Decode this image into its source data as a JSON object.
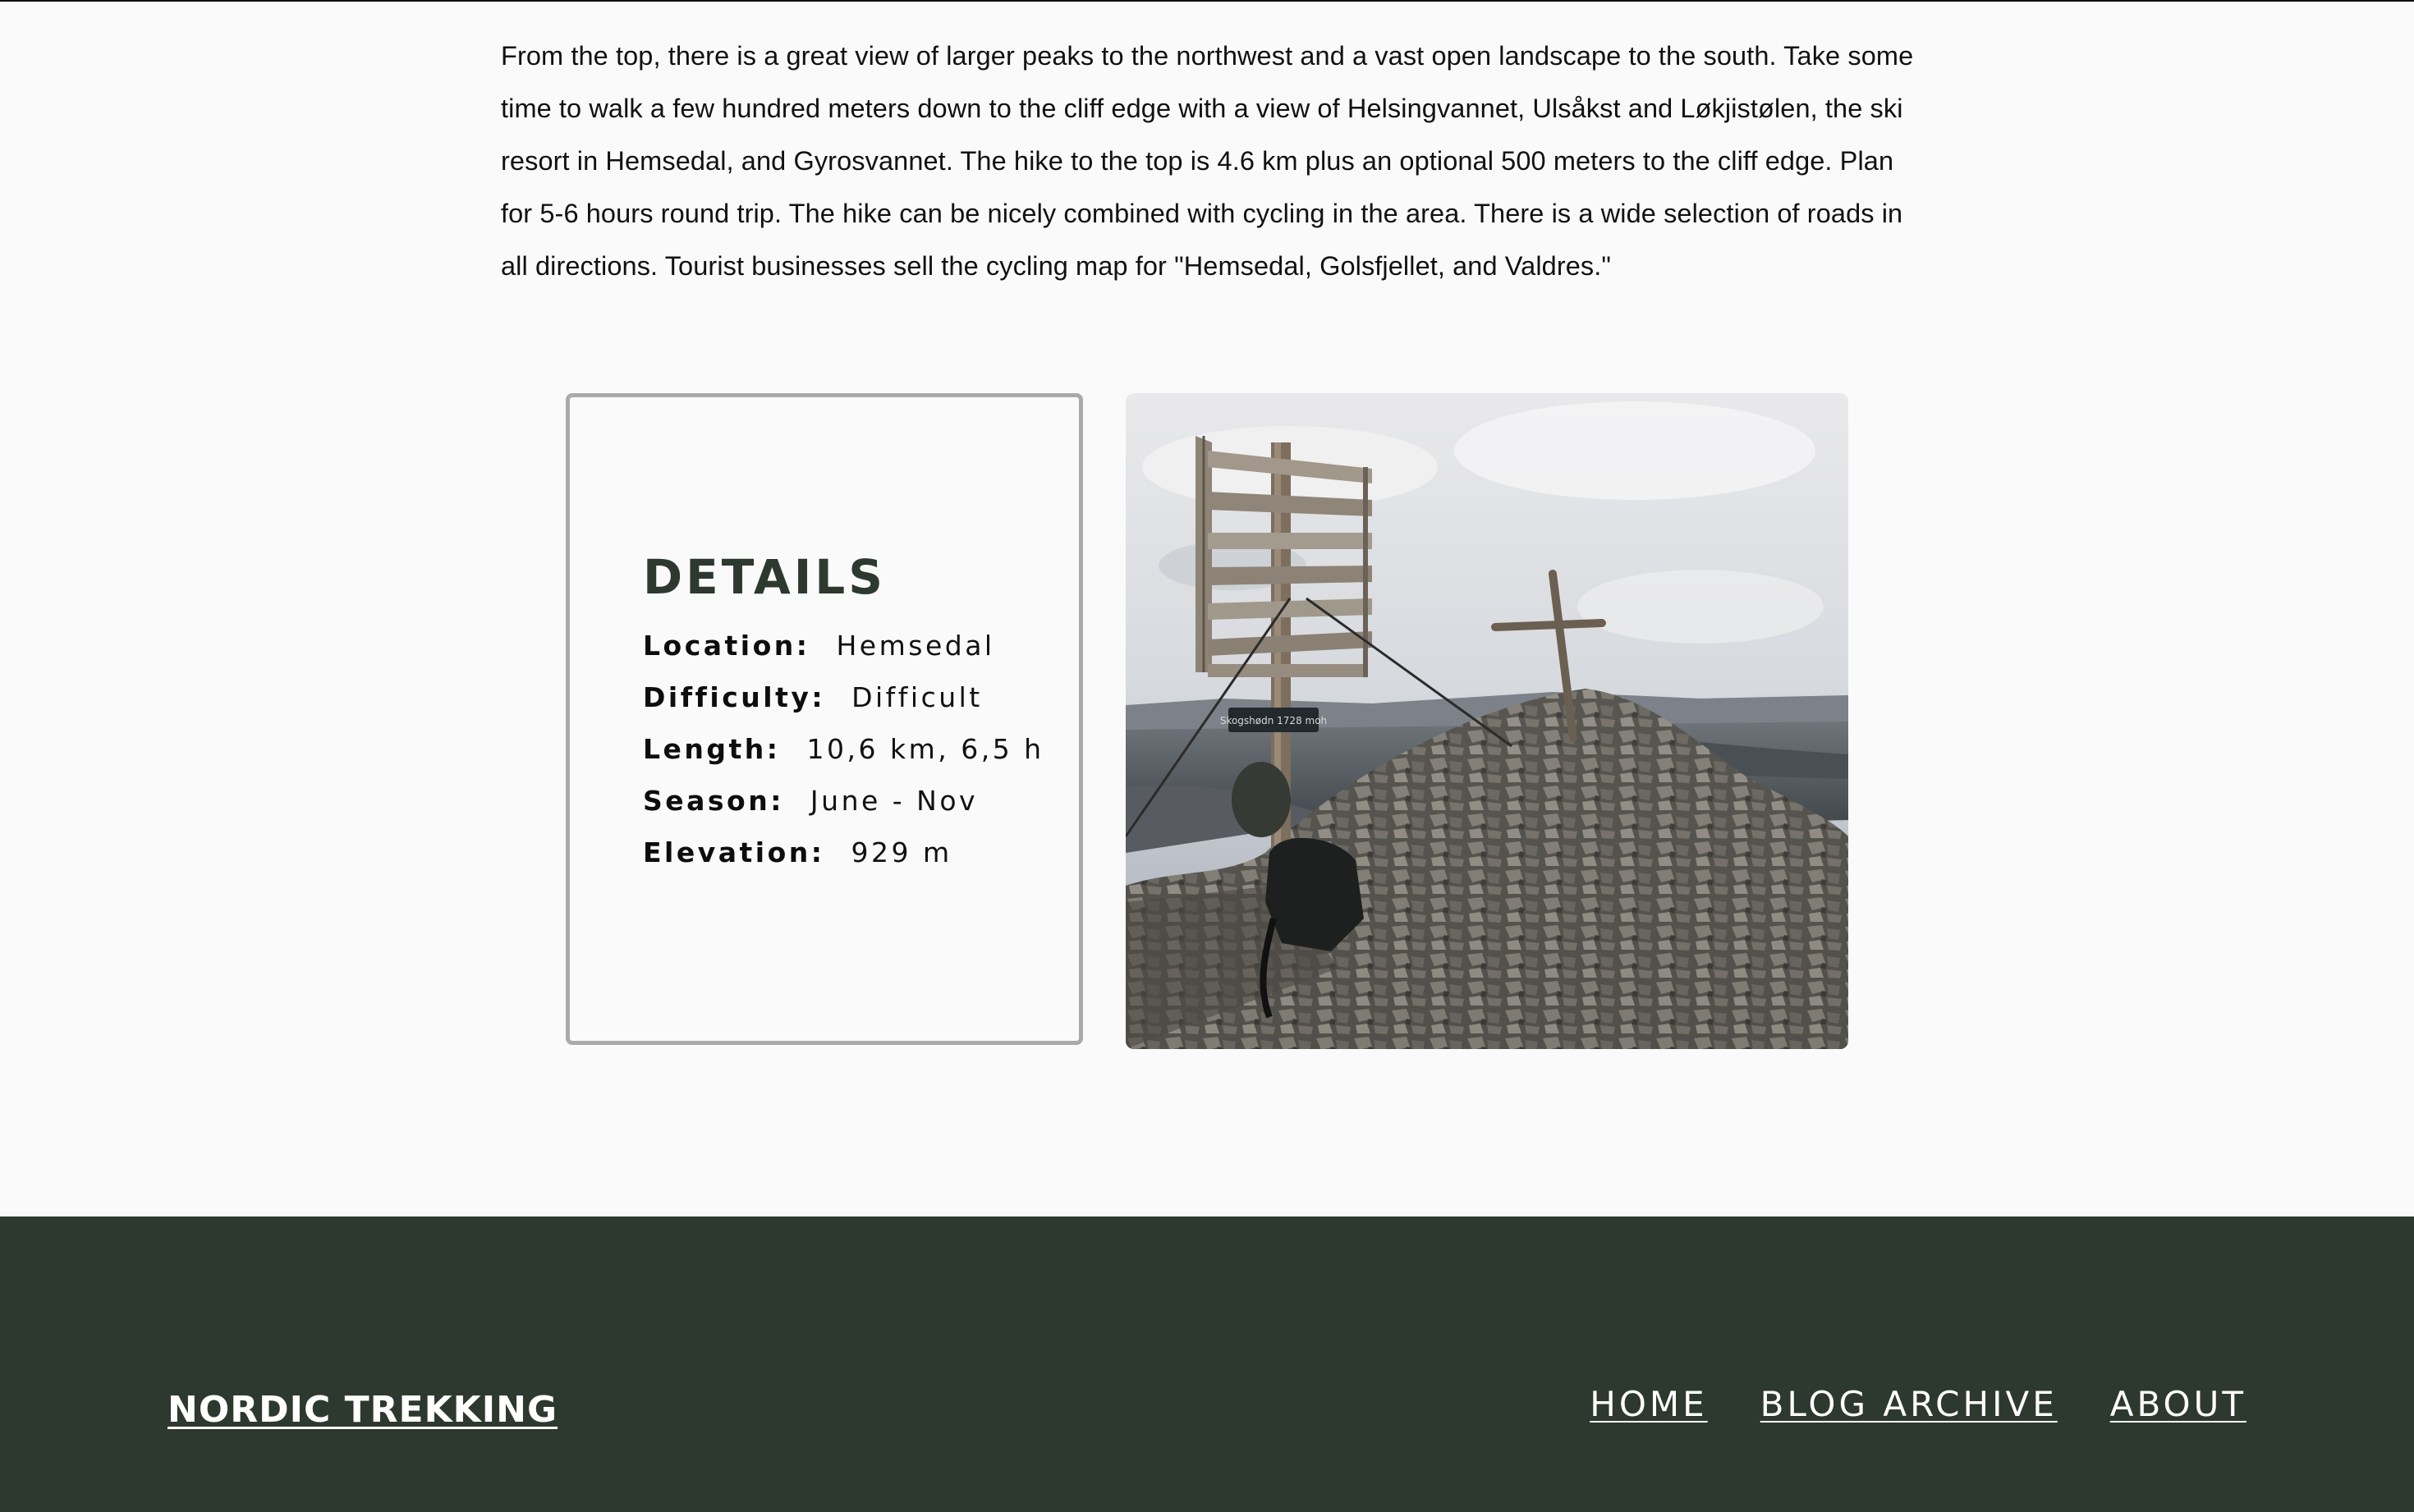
{
  "article": {
    "intro_text": "From the top, there is a great view of larger peaks to the northwest and a vast open landscape to the south. Take some time to walk a few hundred meters down to the cliff edge with a view of Helsingvannet, Ulsåkst and Løkjistølen, the ski resort in Hemsedal, and Gyrosvannet. The hike to the top is 4.6 km plus an optional 500 meters to the cliff edge. Plan for 5-6 hours round trip. The hike can be nicely combined with cycling in the area. There is a wide selection of roads in all directions. Tourist businesses sell the cycling map for \"Hemsedal, Golsfjellet, and Valdres.\""
  },
  "details": {
    "title": "DETAILS",
    "items": [
      {
        "label": "Location:",
        "value": "Hemsedal"
      },
      {
        "label": "Difficulty:",
        "value": "Difficult"
      },
      {
        "label": "Length:",
        "value": "10,6 km, 6,5 h"
      },
      {
        "label": "Season:",
        "value": "June - Nov"
      },
      {
        "label": "Elevation:",
        "value": "929 m"
      }
    ]
  },
  "photo": {
    "sign_text": "Skogshødn 1728 moh"
  },
  "footer": {
    "brand": "NORDIC TREKKING",
    "nav": [
      "HOME",
      "BLOG ARCHIVE",
      "ABOUT"
    ]
  },
  "colors": {
    "footer_bg": "#2d392e",
    "heading": "#2d392e",
    "card_border": "#aaaaaa",
    "page_bg": "#fafafa"
  }
}
